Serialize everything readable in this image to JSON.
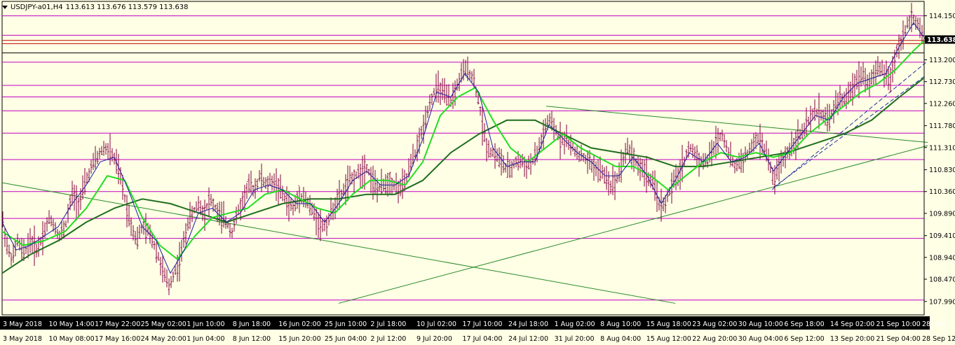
{
  "header": {
    "symbol": "USDJPY-a01,H4",
    "quote": "113.613 113.676 113.579 113.638",
    "menu_icon": "triangle-down-icon"
  },
  "current_price": "113.638",
  "colors": {
    "background": "#ffffe6",
    "candles": "#800040",
    "ma_fast": "#1e1ea0",
    "ma_mid": "#22dd22",
    "ma_slow": "#1e6e1e",
    "levels": "#c000c0",
    "red_level": "#c00000",
    "trendline": "#2a8a2a",
    "channel": "#2030a0",
    "price_box": "#000000",
    "time_bar": "#000000"
  },
  "chart_data": {
    "type": "line",
    "ylim": [
      107.7,
      114.4
    ],
    "y_ticks": [
      "114.150",
      "113.670",
      "113.200",
      "112.730",
      "112.260",
      "111.780",
      "111.310",
      "110.830",
      "110.360",
      "109.890",
      "109.410",
      "108.940",
      "108.470",
      "107.990"
    ],
    "y_tick_values": [
      114.15,
      113.67,
      113.2,
      112.73,
      112.26,
      111.78,
      111.31,
      110.83,
      110.36,
      109.89,
      109.41,
      108.94,
      108.47,
      107.99
    ],
    "time_top": [
      "3 May 2018",
      "10 May 14:00",
      "17 May 22:00",
      "25 May 02:00",
      "1 Jun 10:00",
      "8 Jun 18:00",
      "16 Jun 02:00",
      "25 Jun 10:00",
      "2 Jul 18:00",
      "10 Jul 02:00",
      "17 Jul 10:00",
      "24 Jul 18:00",
      "1 Aug 02:00",
      "8 Aug 10:00",
      "15 Aug 18:00",
      "23 Aug 02:00",
      "30 Aug 10:00",
      "6 Sep 18:00",
      "14 Sep 02:00",
      "21 Sep 10:00",
      "28 Sep 1"
    ],
    "time_bottom": [
      "3 May 2018",
      "10 May 08:00",
      "17 May 16:00",
      "24 May 20:00",
      "1 Jun 04:00",
      "8 Jun 12:00",
      "15 Jun 20:00",
      "25 Jun 04:00",
      "2 Jul 12:00",
      "9 Jul 20:00",
      "17 Jul 04:00",
      "24 Jul 12:00",
      "31 Jul 20:00",
      "8 Aug 04:00",
      "15 Aug 12:00",
      "22 Aug 20:00",
      "30 Aug 04:00",
      "6 Sep 12:00",
      "13 Sep 20:00",
      "21 Sep 04:00",
      "28 Sep 12:00"
    ],
    "horizontal_levels": [
      114.15,
      113.73,
      113.15,
      112.65,
      112.4,
      112.1,
      111.62,
      111.05,
      110.36,
      109.78,
      109.35,
      108.02
    ],
    "red_levels": [
      113.62,
      113.55
    ],
    "black_level": 113.35,
    "price_path": [
      [
        0,
        109.8
      ],
      [
        8,
        109.1
      ],
      [
        15,
        108.9
      ],
      [
        22,
        109.3
      ],
      [
        30,
        109.0
      ],
      [
        40,
        109.3
      ],
      [
        50,
        109.1
      ],
      [
        60,
        109.5
      ],
      [
        68,
        109.8
      ],
      [
        75,
        109.6
      ],
      [
        82,
        109.4
      ],
      [
        90,
        109.6
      ],
      [
        100,
        110.3
      ],
      [
        110,
        110.1
      ],
      [
        120,
        110.6
      ],
      [
        128,
        110.9
      ],
      [
        136,
        111.1
      ],
      [
        145,
        111.3
      ],
      [
        155,
        111.2
      ],
      [
        162,
        111.0
      ],
      [
        170,
        110.6
      ],
      [
        178,
        110.0
      ],
      [
        185,
        109.6
      ],
      [
        192,
        109.3
      ],
      [
        200,
        109.6
      ],
      [
        208,
        109.5
      ],
      [
        215,
        109.3
      ],
      [
        222,
        109.0
      ],
      [
        230,
        108.6
      ],
      [
        238,
        108.3
      ],
      [
        245,
        108.6
      ],
      [
        252,
        108.8
      ],
      [
        258,
        109.2
      ],
      [
        265,
        109.7
      ],
      [
        272,
        109.9
      ],
      [
        280,
        110.1
      ],
      [
        288,
        109.9
      ],
      [
        296,
        110.2
      ],
      [
        304,
        110.0
      ],
      [
        312,
        109.8
      ],
      [
        320,
        109.7
      ],
      [
        328,
        109.5
      ],
      [
        336,
        109.9
      ],
      [
        344,
        110.2
      ],
      [
        352,
        110.5
      ],
      [
        360,
        110.4
      ],
      [
        368,
        110.7
      ],
      [
        376,
        110.5
      ],
      [
        384,
        110.6
      ],
      [
        392,
        110.5
      ],
      [
        400,
        110.3
      ],
      [
        408,
        110.1
      ],
      [
        416,
        110.0
      ],
      [
        424,
        110.3
      ],
      [
        432,
        110.2
      ],
      [
        440,
        110.0
      ],
      [
        448,
        109.8
      ],
      [
        456,
        109.6
      ],
      [
        464,
        109.7
      ],
      [
        472,
        110.0
      ],
      [
        480,
        110.2
      ],
      [
        488,
        110.4
      ],
      [
        496,
        110.6
      ],
      [
        504,
        110.7
      ],
      [
        512,
        110.8
      ],
      [
        520,
        110.9
      ],
      [
        528,
        110.6
      ],
      [
        536,
        110.4
      ],
      [
        544,
        110.5
      ],
      [
        552,
        110.6
      ],
      [
        560,
        110.5
      ],
      [
        568,
        110.4
      ],
      [
        576,
        110.6
      ],
      [
        584,
        111.0
      ],
      [
        592,
        111.3
      ],
      [
        600,
        111.7
      ],
      [
        608,
        112.2
      ],
      [
        616,
        112.5
      ],
      [
        624,
        112.6
      ],
      [
        632,
        112.4
      ],
      [
        640,
        112.3
      ],
      [
        648,
        112.6
      ],
      [
        656,
        112.9
      ],
      [
        664,
        113.0
      ],
      [
        672,
        112.8
      ],
      [
        680,
        112.3
      ],
      [
        686,
        111.7
      ],
      [
        692,
        111.3
      ],
      [
        700,
        111.2
      ],
      [
        708,
        111.1
      ],
      [
        716,
        110.9
      ],
      [
        724,
        110.8
      ],
      [
        732,
        111.0
      ],
      [
        740,
        111.0
      ],
      [
        748,
        110.9
      ],
      [
        756,
        111.0
      ],
      [
        764,
        111.2
      ],
      [
        772,
        111.6
      ],
      [
        780,
        111.9
      ],
      [
        788,
        111.7
      ],
      [
        796,
        111.5
      ],
      [
        804,
        111.5
      ],
      [
        812,
        111.3
      ],
      [
        820,
        111.2
      ],
      [
        828,
        111.1
      ],
      [
        836,
        111.0
      ],
      [
        844,
        110.9
      ],
      [
        852,
        110.8
      ],
      [
        860,
        110.7
      ],
      [
        868,
        110.5
      ],
      [
        876,
        110.6
      ],
      [
        884,
        111.0
      ],
      [
        892,
        111.3
      ],
      [
        900,
        111.1
      ],
      [
        908,
        110.9
      ],
      [
        916,
        110.8
      ],
      [
        924,
        110.6
      ],
      [
        932,
        110.4
      ],
      [
        940,
        110.0
      ],
      [
        948,
        110.2
      ],
      [
        956,
        110.5
      ],
      [
        964,
        110.7
      ],
      [
        972,
        111.0
      ],
      [
        980,
        111.3
      ],
      [
        988,
        111.2
      ],
      [
        996,
        111.0
      ],
      [
        1004,
        111.0
      ],
      [
        1012,
        111.2
      ],
      [
        1020,
        111.5
      ],
      [
        1028,
        111.6
      ],
      [
        1036,
        111.2
      ],
      [
        1044,
        110.9
      ],
      [
        1052,
        111.0
      ],
      [
        1060,
        111.1
      ],
      [
        1068,
        111.3
      ],
      [
        1076,
        111.5
      ],
      [
        1084,
        111.4
      ],
      [
        1092,
        111.1
      ],
      [
        1100,
        110.6
      ],
      [
        1108,
        110.9
      ],
      [
        1116,
        111.1
      ],
      [
        1124,
        111.3
      ],
      [
        1132,
        111.5
      ],
      [
        1140,
        111.6
      ],
      [
        1148,
        111.8
      ],
      [
        1156,
        112.0
      ],
      [
        1164,
        112.1
      ],
      [
        1172,
        112.0
      ],
      [
        1180,
        111.9
      ],
      [
        1188,
        112.2
      ],
      [
        1196,
        112.4
      ],
      [
        1204,
        112.3
      ],
      [
        1212,
        112.6
      ],
      [
        1220,
        112.8
      ],
      [
        1228,
        112.9
      ],
      [
        1236,
        112.7
      ],
      [
        1244,
        112.9
      ],
      [
        1252,
        113.0
      ],
      [
        1260,
        112.9
      ],
      [
        1268,
        112.8
      ],
      [
        1276,
        113.4
      ],
      [
        1284,
        113.7
      ],
      [
        1292,
        114.0
      ],
      [
        1300,
        114.1
      ],
      [
        1308,
        113.9
      ],
      [
        1314,
        113.64
      ]
    ],
    "ma_fast": [
      [
        0,
        109.7
      ],
      [
        20,
        109.1
      ],
      [
        40,
        109.2
      ],
      [
        60,
        109.4
      ],
      [
        80,
        109.6
      ],
      [
        100,
        110.1
      ],
      [
        120,
        110.5
      ],
      [
        140,
        111.0
      ],
      [
        160,
        111.1
      ],
      [
        180,
        110.4
      ],
      [
        200,
        109.6
      ],
      [
        220,
        109.3
      ],
      [
        240,
        108.6
      ],
      [
        260,
        109.1
      ],
      [
        280,
        109.9
      ],
      [
        300,
        110.0
      ],
      [
        320,
        109.7
      ],
      [
        340,
        109.9
      ],
      [
        360,
        110.4
      ],
      [
        380,
        110.5
      ],
      [
        400,
        110.4
      ],
      [
        420,
        110.1
      ],
      [
        440,
        110.1
      ],
      [
        460,
        109.7
      ],
      [
        480,
        110.1
      ],
      [
        500,
        110.6
      ],
      [
        520,
        110.8
      ],
      [
        540,
        110.5
      ],
      [
        560,
        110.5
      ],
      [
        580,
        110.7
      ],
      [
        600,
        111.5
      ],
      [
        620,
        112.5
      ],
      [
        640,
        112.4
      ],
      [
        660,
        112.9
      ],
      [
        680,
        112.5
      ],
      [
        700,
        111.3
      ],
      [
        720,
        110.9
      ],
      [
        740,
        111.0
      ],
      [
        760,
        111.0
      ],
      [
        780,
        111.8
      ],
      [
        800,
        111.5
      ],
      [
        820,
        111.2
      ],
      [
        840,
        111.0
      ],
      [
        860,
        110.7
      ],
      [
        880,
        110.7
      ],
      [
        900,
        111.1
      ],
      [
        920,
        110.7
      ],
      [
        940,
        110.1
      ],
      [
        960,
        110.6
      ],
      [
        980,
        111.2
      ],
      [
        1000,
        111.0
      ],
      [
        1020,
        111.4
      ],
      [
        1040,
        111.0
      ],
      [
        1060,
        111.1
      ],
      [
        1080,
        111.4
      ],
      [
        1100,
        110.8
      ],
      [
        1120,
        111.2
      ],
      [
        1140,
        111.6
      ],
      [
        1160,
        112.0
      ],
      [
        1180,
        111.9
      ],
      [
        1200,
        112.4
      ],
      [
        1220,
        112.7
      ],
      [
        1240,
        112.8
      ],
      [
        1260,
        112.9
      ],
      [
        1280,
        113.5
      ],
      [
        1300,
        114.0
      ],
      [
        1314,
        113.7
      ]
    ],
    "ma_mid": [
      [
        0,
        109.5
      ],
      [
        30,
        109.2
      ],
      [
        60,
        109.3
      ],
      [
        90,
        109.5
      ],
      [
        120,
        110.0
      ],
      [
        150,
        110.7
      ],
      [
        175,
        110.6
      ],
      [
        200,
        109.8
      ],
      [
        225,
        109.2
      ],
      [
        250,
        108.9
      ],
      [
        275,
        109.4
      ],
      [
        300,
        109.8
      ],
      [
        325,
        109.9
      ],
      [
        350,
        110.0
      ],
      [
        375,
        110.3
      ],
      [
        400,
        110.4
      ],
      [
        425,
        110.2
      ],
      [
        450,
        110.0
      ],
      [
        475,
        109.9
      ],
      [
        500,
        110.3
      ],
      [
        525,
        110.6
      ],
      [
        550,
        110.6
      ],
      [
        575,
        110.5
      ],
      [
        600,
        111.0
      ],
      [
        625,
        112.0
      ],
      [
        650,
        112.4
      ],
      [
        675,
        112.6
      ],
      [
        700,
        111.9
      ],
      [
        725,
        111.3
      ],
      [
        750,
        111.0
      ],
      [
        775,
        111.3
      ],
      [
        800,
        111.6
      ],
      [
        825,
        111.3
      ],
      [
        850,
        111.1
      ],
      [
        875,
        110.9
      ],
      [
        900,
        110.9
      ],
      [
        925,
        110.7
      ],
      [
        950,
        110.4
      ],
      [
        975,
        110.7
      ],
      [
        1000,
        111.0
      ],
      [
        1025,
        111.2
      ],
      [
        1050,
        111.1
      ],
      [
        1075,
        111.2
      ],
      [
        1100,
        111.1
      ],
      [
        1125,
        111.2
      ],
      [
        1150,
        111.6
      ],
      [
        1175,
        111.9
      ],
      [
        1200,
        112.2
      ],
      [
        1225,
        112.5
      ],
      [
        1250,
        112.7
      ],
      [
        1275,
        113.0
      ],
      [
        1300,
        113.4
      ],
      [
        1314,
        113.6
      ]
    ],
    "ma_slow": [
      [
        0,
        108.6
      ],
      [
        40,
        109.0
      ],
      [
        80,
        109.3
      ],
      [
        120,
        109.7
      ],
      [
        160,
        110.0
      ],
      [
        200,
        110.2
      ],
      [
        240,
        110.1
      ],
      [
        280,
        109.9
      ],
      [
        320,
        109.7
      ],
      [
        360,
        109.9
      ],
      [
        400,
        110.1
      ],
      [
        440,
        110.2
      ],
      [
        480,
        110.2
      ],
      [
        520,
        110.3
      ],
      [
        560,
        110.3
      ],
      [
        600,
        110.6
      ],
      [
        640,
        111.2
      ],
      [
        680,
        111.6
      ],
      [
        720,
        111.9
      ],
      [
        760,
        111.9
      ],
      [
        800,
        111.6
      ],
      [
        840,
        111.3
      ],
      [
        880,
        111.2
      ],
      [
        920,
        111.1
      ],
      [
        960,
        110.9
      ],
      [
        1000,
        110.9
      ],
      [
        1040,
        111.0
      ],
      [
        1080,
        111.1
      ],
      [
        1120,
        111.2
      ],
      [
        1160,
        111.4
      ],
      [
        1200,
        111.6
      ],
      [
        1240,
        111.9
      ],
      [
        1280,
        112.4
      ],
      [
        1314,
        112.8
      ]
    ],
    "trendlines": [
      {
        "from": [
          0,
          110.55
        ],
        "to": [
          960,
          107.95
        ]
      },
      {
        "from": [
          480,
          107.95
        ],
        "to": [
          1320,
          111.35
        ]
      },
      {
        "from": [
          776,
          112.2
        ],
        "to": [
          1320,
          111.42
        ]
      }
    ],
    "channel_lines": [
      {
        "from": [
          1098,
          110.4
        ],
        "to": [
          1318,
          113.15
        ]
      },
      {
        "from": [
          1100,
          110.45
        ],
        "to": [
          1316,
          112.85
        ]
      }
    ]
  }
}
